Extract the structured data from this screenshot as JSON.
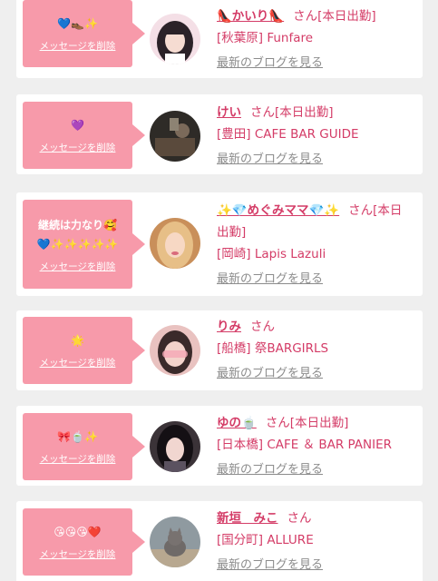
{
  "delete_label": "メッセージを削除",
  "blog_label": "最新のブログを見る",
  "cards": [
    {
      "message": "💙👞✨",
      "name": "👠かいり👠",
      "suffix": "さん[本日出勤]",
      "shop": "[秋葉原] Funfare",
      "avatar": "girl-pink-hair"
    },
    {
      "message": "💜",
      "name": "けい",
      "suffix": "さん[本日出勤]",
      "shop": "[豊田] CAFE BAR GUIDE",
      "avatar": "dark-room"
    },
    {
      "message": "継続は力なり🥰\n💙✨✨✨✨✨",
      "name": "✨💎めぐみママ💎✨",
      "suffix": "さん[本日出勤]",
      "shop": "[岡崎] Lapis Lazuli",
      "avatar": "blonde-woman"
    },
    {
      "message": "🌟",
      "name": "りみ",
      "suffix": "さん",
      "shop": "[船橋] 祭BARGIRLS",
      "avatar": "pink-blur"
    },
    {
      "message": "🎀🍵✨",
      "name": "ゆの🍵",
      "suffix": "さん[本日出勤]",
      "shop": "[日本橋] CAFE ＆ BAR PANIER",
      "avatar": "dark-hair-girl"
    },
    {
      "message": "😘😘😘❤️",
      "name": "新垣　みこ",
      "suffix": "さん",
      "shop": "[国分町] ALLURE",
      "avatar": "cat"
    }
  ]
}
